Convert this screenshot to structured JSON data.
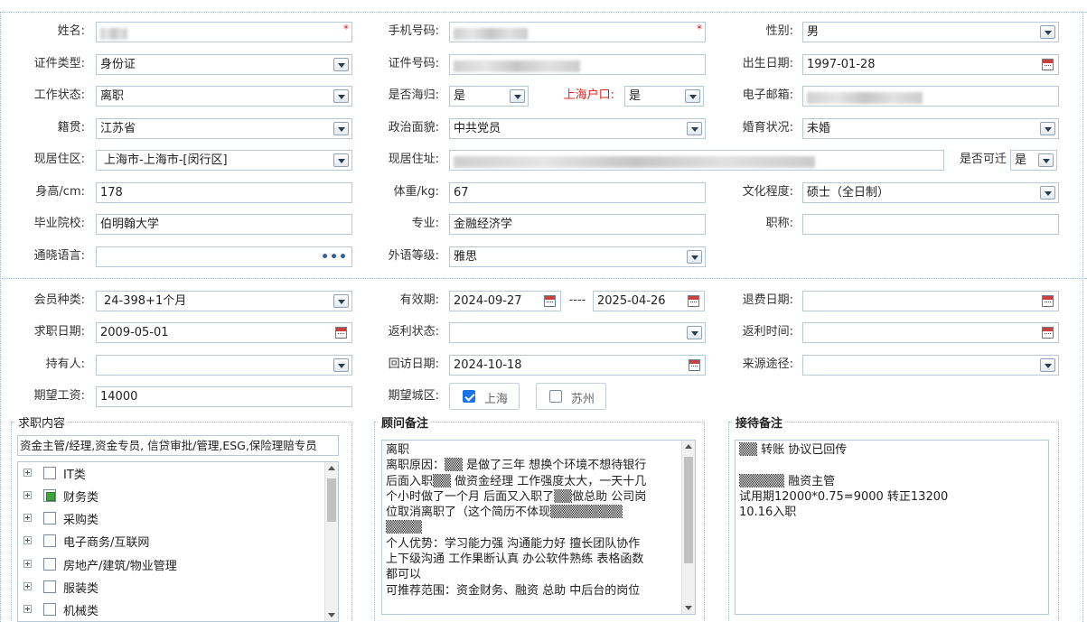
{
  "basic": {
    "name_label": "姓名:",
    "phone_label": "手机号码:",
    "gender_label": "性别:",
    "gender_value": "男",
    "idtype_label": "证件类型:",
    "idtype_value": "身份证",
    "idno_label": "证件号码:",
    "birth_label": "出生日期:",
    "birth_value": "1997-01-28",
    "workstatus_label": "工作状态:",
    "workstatus_value": "离职",
    "returnee_label": "是否海归:",
    "returnee_value": "是",
    "hukou_label": "上海户口:",
    "hukou_value": "是",
    "email_label": "电子邮箱:",
    "native_label": "籍贯:",
    "native_value": "江苏省",
    "political_label": "政治面貌:",
    "political_value": "中共党员",
    "marital_label": "婚育状况:",
    "marital_value": "未婚",
    "residence_area_label": "现居住区:",
    "residence_area_value": "上海市-上海市-[闵行区]",
    "address_label": "现居住址:",
    "relocate_label": "是否可迁",
    "relocate_value": "是",
    "height_label": "身高/cm:",
    "height_value": "178",
    "weight_label": "体重/kg:",
    "weight_value": "67",
    "education_label": "文化程度:",
    "education_value": "硕士（全日制）",
    "school_label": "毕业院校:",
    "school_value": "伯明翰大学",
    "major_label": "专业:",
    "major_value": "金融经济学",
    "title_label": "职称:",
    "language_label": "通晓语言:",
    "foreign_level_label": "外语等级:",
    "foreign_level_value": "雅思"
  },
  "membership": {
    "member_type_label": "会员种类:",
    "member_type_value": "24-398+1个月",
    "valid_label": "有效期:",
    "valid_from": "2024-09-27",
    "valid_sep": "----",
    "valid_to": "2025-04-26",
    "refund_date_label": "退费日期:",
    "job_date_label": "求职日期:",
    "job_date_value": "2009-05-01",
    "rebate_status_label": "返利状态:",
    "rebate_time_label": "返利时间:",
    "holder_label": "持有人:",
    "revisit_label": "回访日期:",
    "revisit_value": "2024-10-18",
    "source_label": "来源途径:",
    "salary_label": "期望工资:",
    "salary_value": "14000",
    "city_label": "期望城区:",
    "city_options": [
      {
        "label": "上海",
        "checked": true
      },
      {
        "label": "苏州",
        "checked": false
      }
    ]
  },
  "job_content": {
    "legend": "求职内容",
    "summary": "资金主管/经理,资金专员, 信贷审批/管理,ESG,保险理赔专员",
    "tree": [
      {
        "label": "IT类",
        "checked": false
      },
      {
        "label": "财务类",
        "checked": true
      },
      {
        "label": "采购类",
        "checked": false
      },
      {
        "label": "电子商务/互联网",
        "checked": false
      },
      {
        "label": "房地产/建筑/物业管理",
        "checked": false
      },
      {
        "label": "服装类",
        "checked": false
      },
      {
        "label": "机械类",
        "checked": false
      }
    ]
  },
  "consultant_note": {
    "legend": "顾问备注",
    "lines": [
      "离职",
      "离职原因：▒▒ 是做了三年 想换个环境不想待银行",
      "后面入职▒▒ 做资金经理 工作强度太大，一天十几",
      "个小时做了一个月 后面又入职了▒▒做总助 公司岗",
      "位取消离职了（这个简历不体现▒▒▒▒▒▒▒▒",
      "▒▒▒▒",
      "个人优势：学习能力强 沟通能力好 擅长团队协作",
      "上下级沟通 工作果断认真 办公软件熟练 表格函数",
      "都可以",
      "可推荐范围：资金财务、融资 总助 中后台的岗位"
    ]
  },
  "reception_note": {
    "legend": "接待备注",
    "lines": [
      "▒▒ 转账 协议已回传",
      "",
      "▒▒▒▒▒   融资主管",
      "试用期12000*0.75=9000  转正13200",
      "10.16入职"
    ]
  }
}
